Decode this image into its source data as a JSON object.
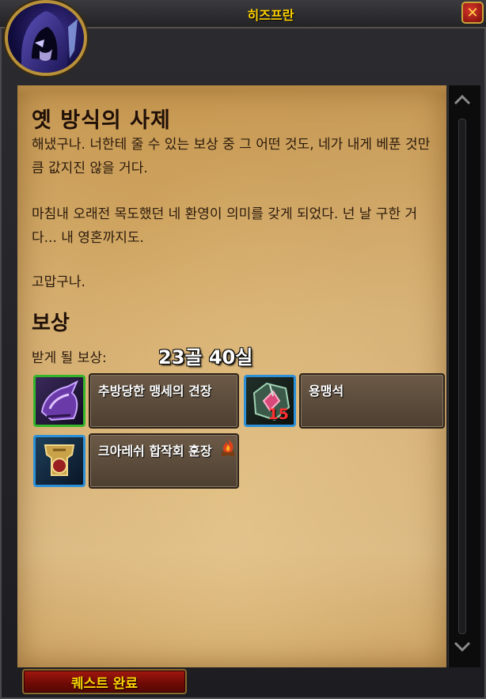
{
  "window": {
    "title": "히즈프란",
    "close_label": "✕"
  },
  "quest": {
    "title": "옛 방식의 사제",
    "paragraphs": [
      "해냈구나. 너한테 줄 수 있는 보상 중 그 어떤 것도, 네가 내게 베푼 것만큼 값지진 않을 거다.",
      "마침내 오래전 목도했던 네 환영이 의미를 갖게 되었다. 넌 날 구한 거다... 내 영혼까지도.",
      "고맙구나."
    ]
  },
  "rewards": {
    "section_title": "보상",
    "receive_label": "받게 될 보상:",
    "money": "23골 40실",
    "items": [
      {
        "name": "추방당한 맹세의 견장",
        "icon": "shoulder-armor-icon",
        "count": ""
      },
      {
        "name": "용맹석",
        "icon": "valorstone-icon",
        "count": "15"
      },
      {
        "name": "크아레쉬 합작회 훈장",
        "icon": "insignia-icon",
        "count": ""
      }
    ]
  },
  "footer": {
    "complete_button": "퀘스트 완료"
  },
  "scrollbar": {
    "up_icon": "chevron-up-icon",
    "down_icon": "chevron-down-icon"
  },
  "colors": {
    "title_gold": "#ffd200",
    "parchment": "#d8b378",
    "item_count_red": "#ff3030",
    "button_red": "#8b1209"
  }
}
